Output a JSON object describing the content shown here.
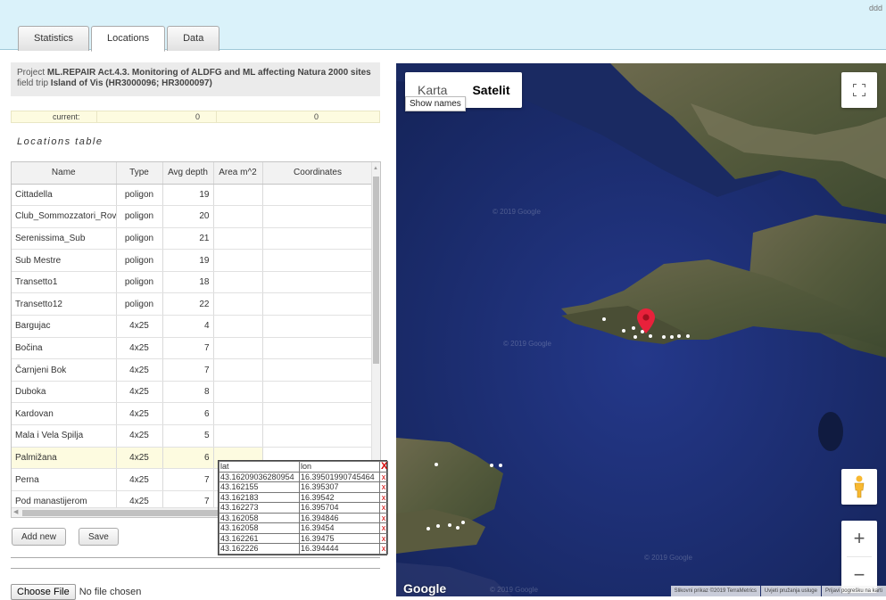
{
  "topbar": {
    "corner_text": "ddd"
  },
  "tabs": [
    {
      "label": "Statistics",
      "active": false
    },
    {
      "label": "Locations",
      "active": true
    },
    {
      "label": "Data",
      "active": false
    }
  ],
  "project": {
    "prefix": "Project ",
    "name": "ML.REPAIR Act.4.3. Monitoring of ALDFG and ML affecting Natura 2000 sites",
    "mid": " field trip ",
    "trip": "Island of Vis (HR3000096; HR3000097)"
  },
  "current": {
    "label": "current:",
    "value1": "0",
    "value2": "0"
  },
  "locations_table": {
    "title": "Locations table",
    "headers": [
      "Name",
      "Type",
      "Avg depth",
      "Area m^2",
      "Coordinates"
    ],
    "rows": [
      {
        "name": "Cittadella",
        "type": "poligon",
        "depth": "19"
      },
      {
        "name": "Club_Sommozzatori_Rovigo",
        "type": "poligon",
        "depth": "20"
      },
      {
        "name": "Serenissima_Sub",
        "type": "poligon",
        "depth": "21"
      },
      {
        "name": "Sub Mestre",
        "type": "poligon",
        "depth": "19"
      },
      {
        "name": "Transetto1",
        "type": "poligon",
        "depth": "18"
      },
      {
        "name": "Transetto12",
        "type": "poligon",
        "depth": "22"
      },
      {
        "name": "Bargujac",
        "type": "4x25",
        "depth": "4"
      },
      {
        "name": "Bočina",
        "type": "4x25",
        "depth": "7"
      },
      {
        "name": "Čarnjeni Bok",
        "type": "4x25",
        "depth": "7"
      },
      {
        "name": "Duboka",
        "type": "4x25",
        "depth": "8"
      },
      {
        "name": "Kardovan",
        "type": "4x25",
        "depth": "6"
      },
      {
        "name": "Mala i Vela Spilja",
        "type": "4x25",
        "depth": "5"
      },
      {
        "name": "Palmižana",
        "type": "4x25",
        "depth": "6"
      },
      {
        "name": "Perna",
        "type": "4x25",
        "depth": "7"
      },
      {
        "name": "Pod manastijerom",
        "type": "4x25",
        "depth": "7"
      }
    ]
  },
  "buttons": {
    "add_new": "Add new",
    "save": "Save"
  },
  "file_input": {
    "button": "Choose File",
    "status": "No file chosen"
  },
  "coord_popup": {
    "lat_label": "lat",
    "lon_label": "lon",
    "close": "X",
    "delete": "x",
    "rows": [
      {
        "lat": "43.16209036280954",
        "lon": "16.39501990745464"
      },
      {
        "lat": "43.162155",
        "lon": "16.395307"
      },
      {
        "lat": "43.162183",
        "lon": "16.39542"
      },
      {
        "lat": "43.162273",
        "lon": "16.395704"
      },
      {
        "lat": "43.162058",
        "lon": "16.394846"
      },
      {
        "lat": "43.162058",
        "lon": "16.39454"
      },
      {
        "lat": "43.162261",
        "lon": "16.39475"
      },
      {
        "lat": "43.162226",
        "lon": "16.394444"
      }
    ]
  },
  "map": {
    "type_map": "Karta",
    "type_satellite": "Satelit",
    "show_names": "Show names",
    "watermark": "© 2019 Google",
    "logo": "Google",
    "zoom_in": "+",
    "zoom_out": "−",
    "attribution": [
      "Slikovni prikaz ©2019 TerraMetrics",
      "Uvjeti pružanja usluge",
      "Prijavi pogrešku na karti"
    ],
    "colors": {
      "sea": "#1a2e6b",
      "marker": "#e8213b"
    }
  }
}
